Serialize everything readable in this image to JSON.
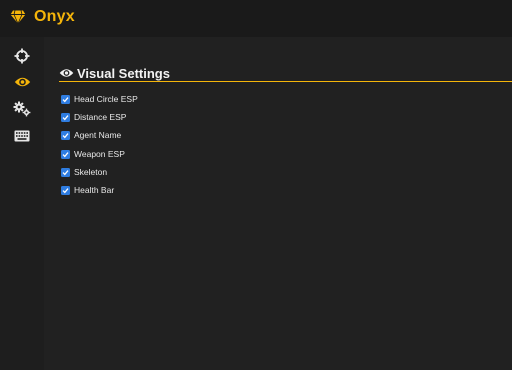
{
  "app": {
    "title": "Onyx",
    "accent_color": "#f5b50a",
    "logo_icon": "diamond-icon"
  },
  "sidebar": {
    "items": [
      {
        "icon": "crosshair-icon",
        "active": false
      },
      {
        "icon": "eye-icon",
        "active": true
      },
      {
        "icon": "gears-icon",
        "active": false
      },
      {
        "icon": "keyboard-icon",
        "active": false
      }
    ]
  },
  "section": {
    "icon": "eye-icon",
    "title": "Visual Settings"
  },
  "options": [
    {
      "label": "Head Circle ESP",
      "checked": true
    },
    {
      "label": "Distance ESP",
      "checked": true
    },
    {
      "label": "Agent Name",
      "checked": true
    },
    {
      "label": "Weapon ESP",
      "checked": true
    },
    {
      "label": "Skeleton",
      "checked": true
    },
    {
      "label": "Health Bar",
      "checked": true
    }
  ],
  "colors": {
    "checkbox": "#2f7de1",
    "background": "#212121",
    "titlebar": "#1a1a1a"
  }
}
